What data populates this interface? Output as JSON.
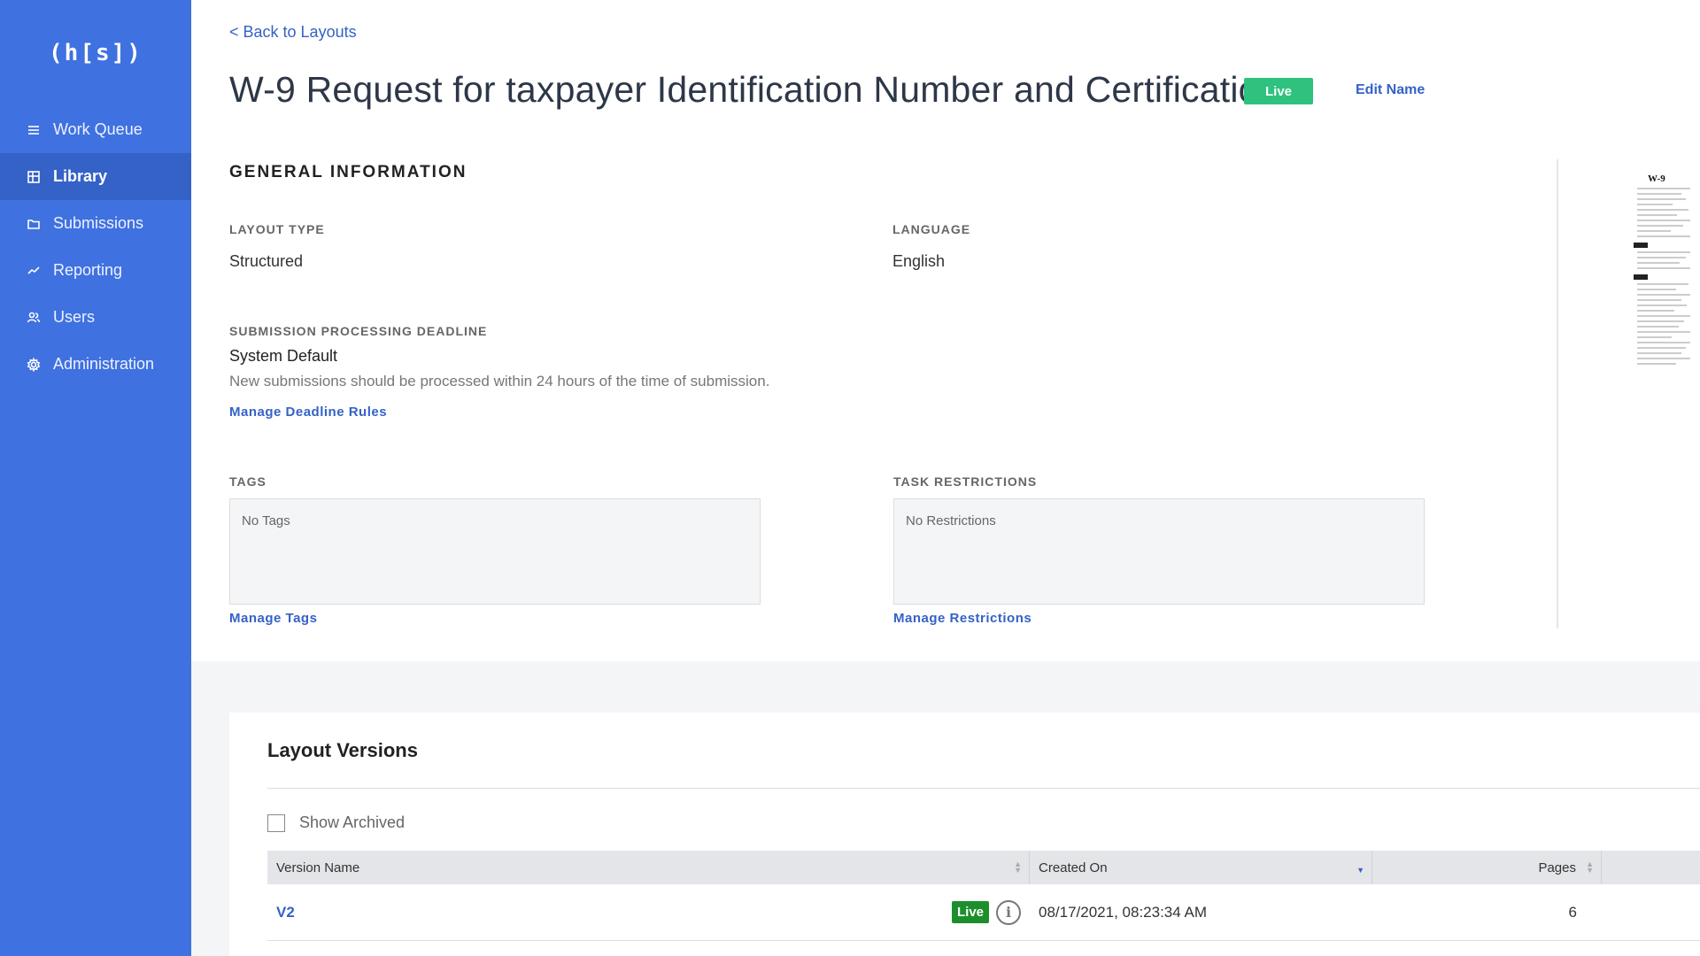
{
  "app": {
    "logo": "(h[s])"
  },
  "sidebar": {
    "items": [
      {
        "label": "Work Queue",
        "icon": "list-icon"
      },
      {
        "label": "Library",
        "icon": "grid-icon",
        "active": true
      },
      {
        "label": "Submissions",
        "icon": "folder-icon"
      },
      {
        "label": "Reporting",
        "icon": "chart-line-icon"
      },
      {
        "label": "Users",
        "icon": "users-icon"
      },
      {
        "label": "Administration",
        "icon": "gear-icon"
      }
    ]
  },
  "header": {
    "back_link": "< Back to Layouts",
    "title": "W-9 Request for taxpayer Identification Number and Certification",
    "status_badge": "Live",
    "edit_name": "Edit Name"
  },
  "general": {
    "section_title": "GENERAL INFORMATION",
    "layout_type_label": "LAYOUT TYPE",
    "layout_type_value": "Structured",
    "language_label": "LANGUAGE",
    "language_value": "English",
    "deadline_label": "SUBMISSION PROCESSING DEADLINE",
    "deadline_value": "System Default",
    "deadline_description": "New submissions should be processed within 24 hours of the time of submission.",
    "manage_deadline_link": "Manage Deadline Rules",
    "tags_label": "TAGS",
    "tags_value": "No Tags",
    "manage_tags_link": "Manage Tags",
    "restrictions_label": "TASK RESTRICTIONS",
    "restrictions_value": "No Restrictions",
    "manage_restrictions_link": "Manage Restrictions"
  },
  "preview": {
    "form_title": "W-9"
  },
  "versions": {
    "title": "Layout Versions",
    "show_archived_label": "Show Archived",
    "show_archived_checked": false,
    "columns": [
      "Version Name",
      "Created On",
      "Pages"
    ],
    "rows": [
      {
        "name": "V2",
        "status": "Live",
        "created_on": "08/17/2021, 08:23:34 AM",
        "pages": "6"
      }
    ]
  },
  "colors": {
    "sidebar": "#3f71e0",
    "sidebar_active": "#3462c6",
    "link": "#3462c6",
    "live_badge": "#2ec27e",
    "row_live_badge": "#1c8f2c"
  }
}
